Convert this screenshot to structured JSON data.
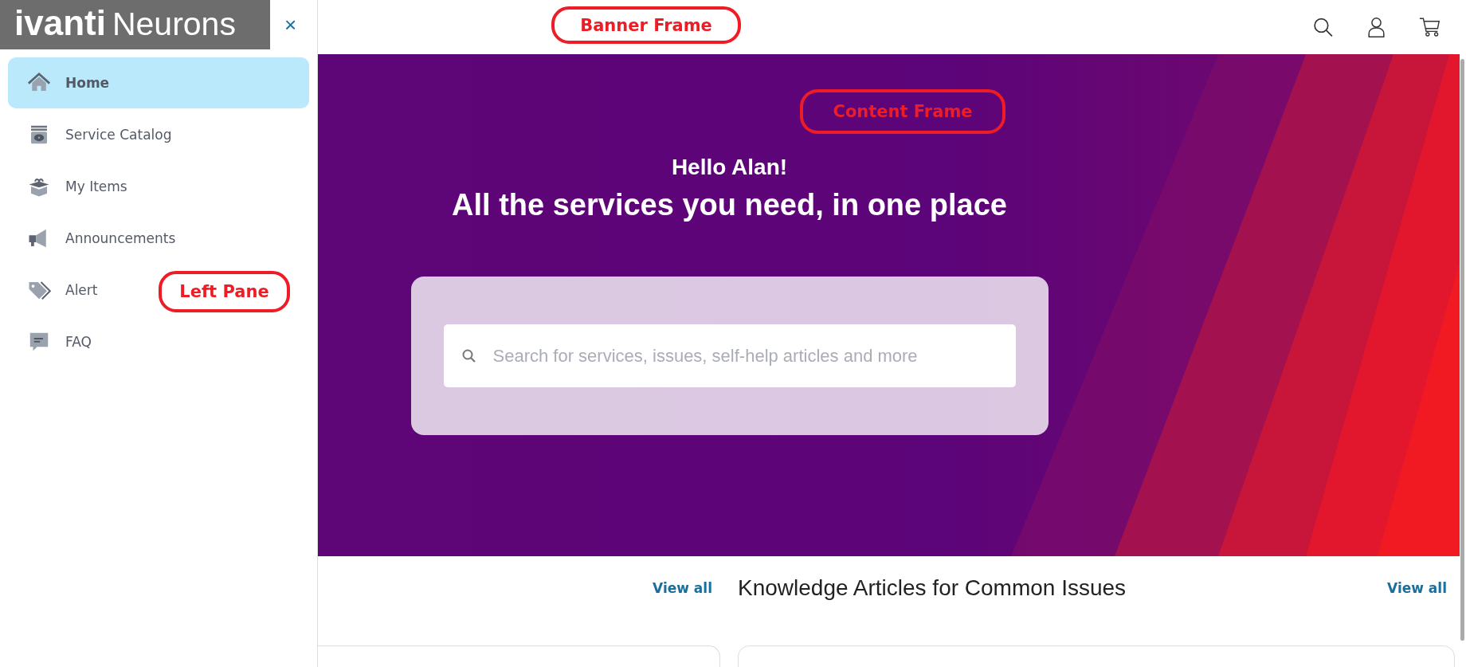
{
  "logo": {
    "brand": "ivanti",
    "product": "Neurons"
  },
  "sidebar": {
    "close": "×",
    "items": [
      {
        "label": "Home",
        "kind": "home",
        "selected": true
      },
      {
        "label": "Service Catalog",
        "kind": "catalog",
        "selected": false
      },
      {
        "label": "My Items",
        "kind": "box",
        "selected": false
      },
      {
        "label": "Announcements",
        "kind": "megaphone",
        "selected": false
      },
      {
        "label": "Alert",
        "kind": "tag",
        "selected": false
      },
      {
        "label": "FAQ",
        "kind": "chat",
        "selected": false
      }
    ]
  },
  "hero": {
    "greeting": "Hello Alan!",
    "headline": "All the services you need, in one place",
    "search": {
      "placeholder": "Search for services, issues, self-help articles and more"
    }
  },
  "sections": [
    {
      "link": "View all"
    },
    {
      "title": "Knowledge Articles for Common Issues",
      "link": "View all"
    }
  ],
  "annotations": [
    "Banner Frame",
    "Content Frame",
    "Left Pane"
  ]
}
